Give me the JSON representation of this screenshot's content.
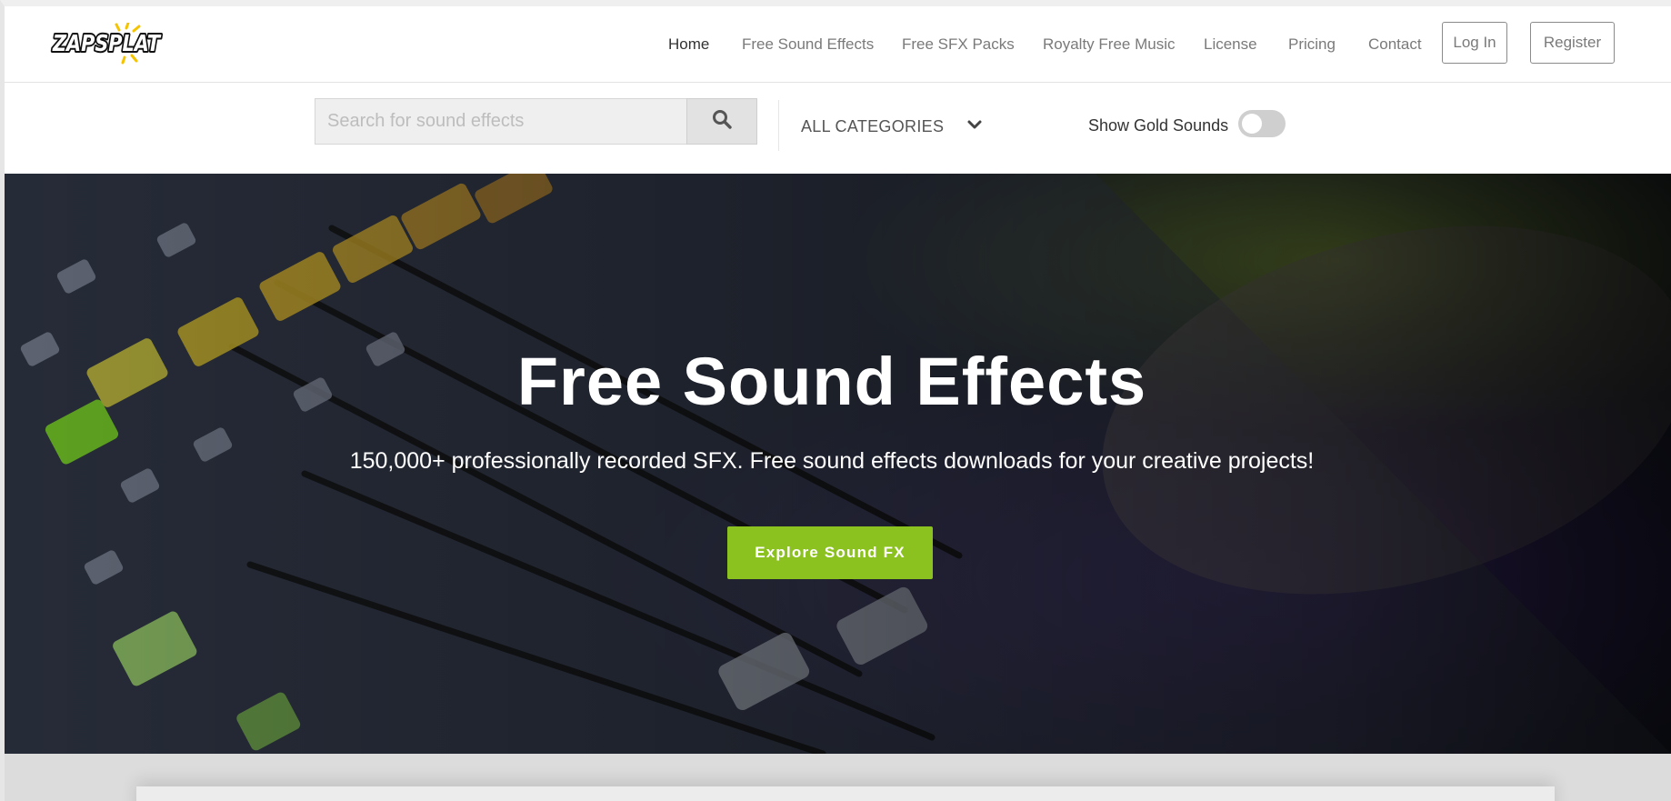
{
  "brand": {
    "logo_text": "ZAPSPLAT",
    "accent_color": "#8cc21f"
  },
  "nav": {
    "links": [
      {
        "label": "Home",
        "active": true
      },
      {
        "label": "Free Sound Effects",
        "active": false
      },
      {
        "label": "Free SFX Packs",
        "active": false
      },
      {
        "label": "Royalty Free Music",
        "active": false
      },
      {
        "label": "License",
        "active": false
      },
      {
        "label": "Pricing",
        "active": false
      },
      {
        "label": "Contact",
        "active": false
      }
    ],
    "login_label": "Log In",
    "register_label": "Register"
  },
  "search": {
    "placeholder": "Search for sound effects",
    "value": "",
    "button_icon": "search-icon"
  },
  "category": {
    "selected": "ALL CATEGORIES",
    "icon": "chevron-down-icon"
  },
  "gold": {
    "label": "Show Gold Sounds",
    "enabled": false
  },
  "hero": {
    "title": "Free Sound Effects",
    "subtitle": "150,000+ professionally recorded SFX. Free sound effects downloads for your creative projects!",
    "cta_label": "Explore Sound FX"
  }
}
